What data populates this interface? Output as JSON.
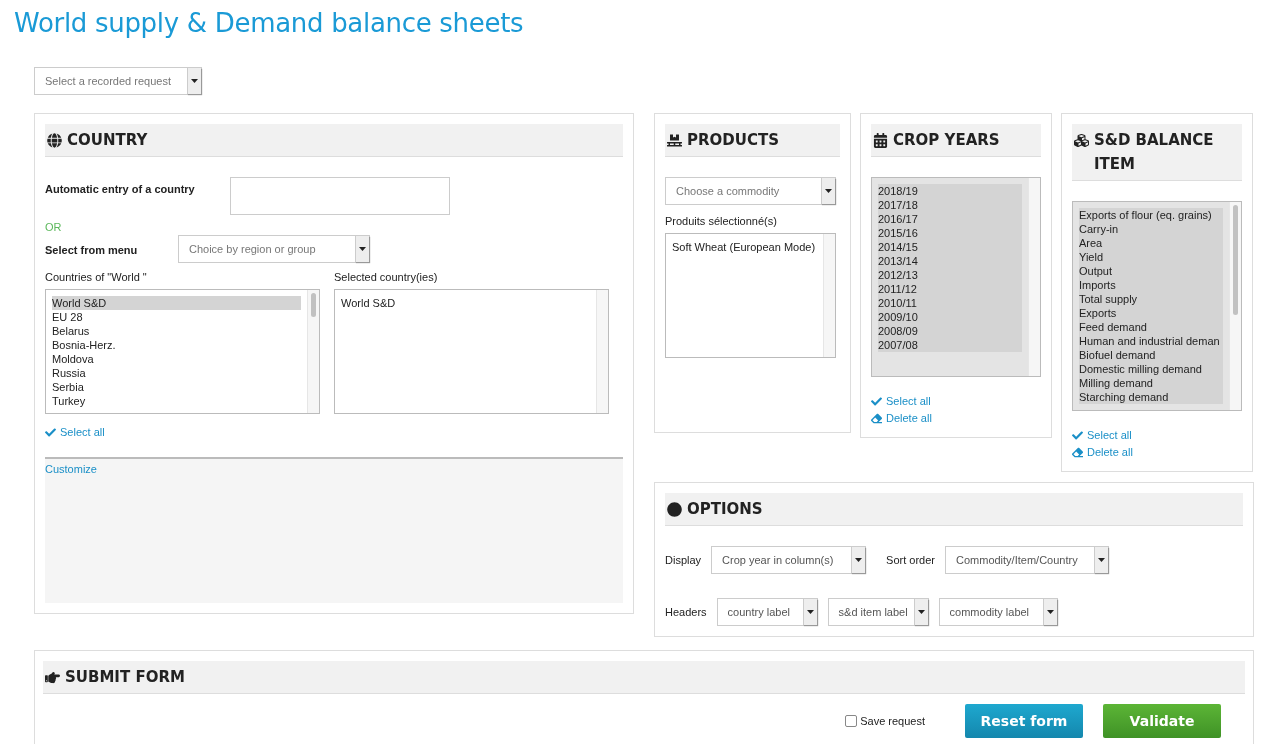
{
  "page_title": "World supply & Demand balance sheets",
  "recorded_request": {
    "placeholder": "Select a recorded request"
  },
  "country": {
    "title": "COUNTRY",
    "auto_entry_label": "Automatic entry of a country",
    "or_label": "OR",
    "menu_label": "Select from menu",
    "menu_select": {
      "placeholder": "Choice by region or group"
    },
    "available_label": "Countries of \"World \"",
    "available": [
      {
        "label": "World S&D",
        "selected": true
      },
      {
        "label": "EU 28",
        "selected": false
      },
      {
        "label": "Belarus",
        "selected": false
      },
      {
        "label": "Bosnia-Herz.",
        "selected": false
      },
      {
        "label": "Moldova",
        "selected": false
      },
      {
        "label": "Russia",
        "selected": false
      },
      {
        "label": "Serbia",
        "selected": false
      },
      {
        "label": "Turkey",
        "selected": false
      }
    ],
    "selected_label": "Selected country(ies)",
    "selected_list": [
      "World S&D"
    ],
    "select_all": "Select all",
    "customize": "Customize"
  },
  "products": {
    "title": "PRODUCTS",
    "select": {
      "placeholder": "Choose a commodity"
    },
    "selected_label": "Produits sélectionné(s)",
    "selected_list": [
      "Soft Wheat (European Mode)"
    ]
  },
  "crop_years": {
    "title": "CROP YEARS",
    "items": [
      {
        "label": "2018/19",
        "selected": true
      },
      {
        "label": "2017/18",
        "selected": true
      },
      {
        "label": "2016/17",
        "selected": true
      },
      {
        "label": "2015/16",
        "selected": true
      },
      {
        "label": "2014/15",
        "selected": true
      },
      {
        "label": "2013/14",
        "selected": true
      },
      {
        "label": "2012/13",
        "selected": true
      },
      {
        "label": "2011/12",
        "selected": true
      },
      {
        "label": "2010/11",
        "selected": true
      },
      {
        "label": "2009/10",
        "selected": true
      },
      {
        "label": "2008/09",
        "selected": true
      },
      {
        "label": "2007/08",
        "selected": true
      }
    ],
    "select_all": "Select all",
    "delete_all": "Delete all"
  },
  "balance_items": {
    "title": "S&D BALANCE ITEM",
    "items": [
      {
        "label": "Exports of flour (eq. grains)",
        "selected": true
      },
      {
        "label": "Carry-in",
        "selected": true
      },
      {
        "label": "Area",
        "selected": true
      },
      {
        "label": "Yield",
        "selected": true
      },
      {
        "label": "Output",
        "selected": true
      },
      {
        "label": "Imports",
        "selected": true
      },
      {
        "label": "Total supply",
        "selected": true
      },
      {
        "label": "Exports",
        "selected": true
      },
      {
        "label": "Feed demand",
        "selected": true
      },
      {
        "label": "Human and industrial deman",
        "selected": true
      },
      {
        "label": "Biofuel demand",
        "selected": true
      },
      {
        "label": "Domestic milling demand",
        "selected": true
      },
      {
        "label": "Milling demand",
        "selected": true
      },
      {
        "label": "Starching demand",
        "selected": true
      }
    ],
    "select_all": "Select all",
    "delete_all": "Delete all"
  },
  "options": {
    "title": "OPTIONS",
    "display_label": "Display",
    "display": {
      "value": "Crop year in column(s)"
    },
    "sort_label": "Sort order",
    "sort": {
      "value": "Commodity/Item/Country"
    },
    "headers_label": "Headers",
    "headers": [
      {
        "value": "country label"
      },
      {
        "value": "s&d item label"
      },
      {
        "value": "commodity label"
      }
    ]
  },
  "submit": {
    "title": "SUBMIT FORM",
    "save_request": {
      "label": "Save request",
      "checked": false
    },
    "reset": "Reset form",
    "validate": "Validate"
  }
}
